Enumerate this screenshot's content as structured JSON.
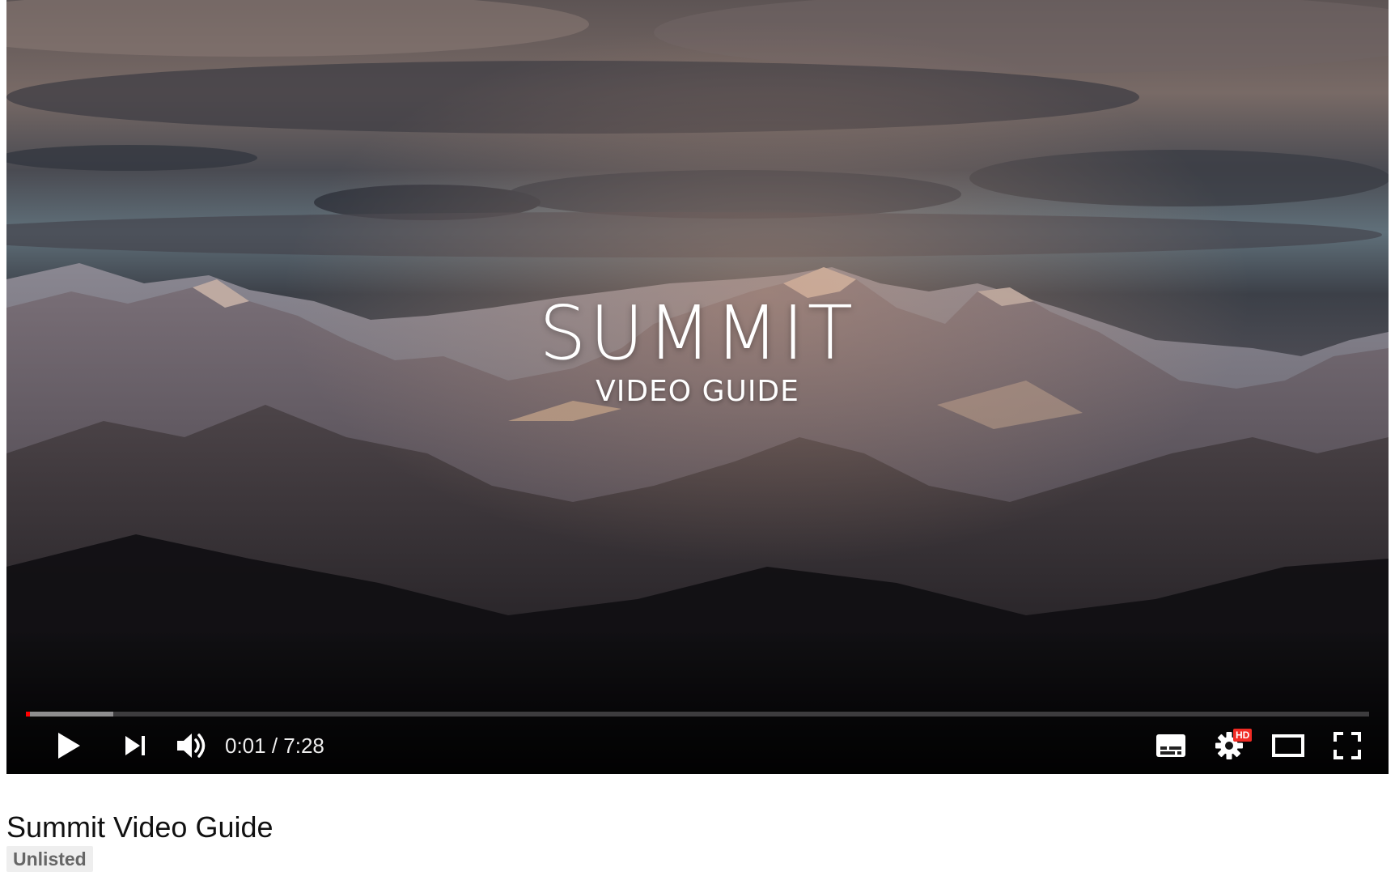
{
  "player": {
    "overlay": {
      "title": "SUMMIT",
      "subtitle": "VIDEO GUIDE"
    },
    "progress": {
      "played_fraction": 0.003,
      "buffered_fraction": 0.065,
      "played_color": "#ff0000"
    },
    "controls": {
      "left": [
        {
          "name": "play-button",
          "icon": "play-icon"
        },
        {
          "name": "next-button",
          "icon": "next-icon"
        },
        {
          "name": "volume-button",
          "icon": "volume-icon"
        }
      ],
      "time_current": "0:01",
      "time_separator": " / ",
      "time_duration": "7:28",
      "right": [
        {
          "name": "subtitles-button",
          "icon": "subtitles-icon"
        },
        {
          "name": "settings-button",
          "icon": "gear-icon",
          "badge": "HD"
        },
        {
          "name": "theater-mode-button",
          "icon": "theater-icon"
        },
        {
          "name": "fullscreen-button",
          "icon": "fullscreen-icon"
        }
      ]
    }
  },
  "video": {
    "title": "Summit Video Guide",
    "privacy_badge": "Unlisted"
  },
  "colors": {
    "hd_badge": "#f12b24",
    "text_primary": "#111111",
    "badge_bg": "#eeeeee",
    "badge_text": "#666666"
  }
}
